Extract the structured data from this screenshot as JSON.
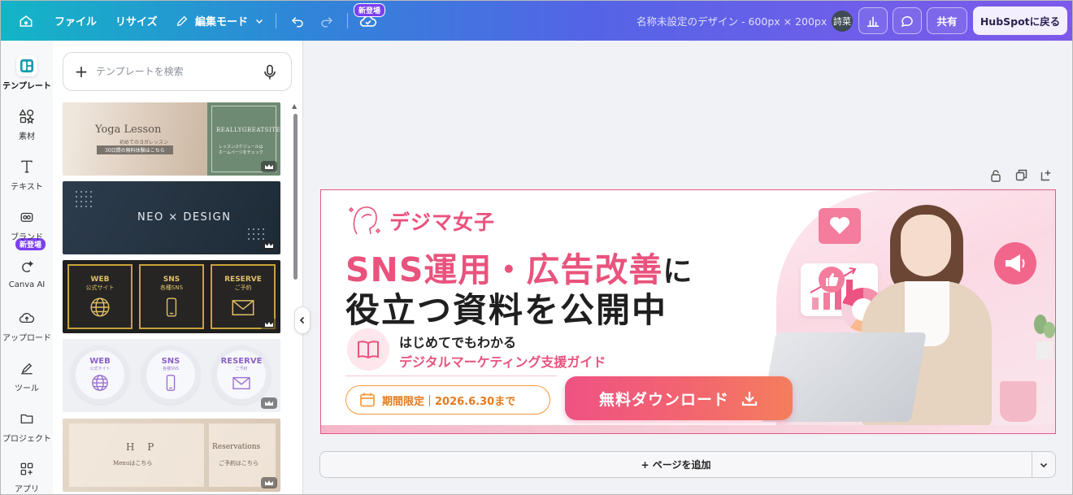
{
  "topbar": {
    "file": "ファイル",
    "resize": "リサイズ",
    "edit_mode": "編集モード",
    "new_badge": "新登場",
    "doc_title": "名称未設定のデザイン - 600px × 200px",
    "avatar": "詩菜",
    "share": "共有",
    "back": "HubSpotに戻る"
  },
  "rail": {
    "items": [
      {
        "label": "テンプレート",
        "icon": "templates-icon"
      },
      {
        "label": "素材",
        "icon": "elements-icon"
      },
      {
        "label": "テキスト",
        "icon": "text-icon"
      },
      {
        "label": "ブランド",
        "icon": "brand-icon"
      },
      {
        "label": "Canva AI",
        "icon": "canva-ai-icon"
      },
      {
        "label": "アップロード",
        "icon": "upload-icon"
      },
      {
        "label": "ツール",
        "icon": "tools-icon"
      },
      {
        "label": "プロジェクト",
        "icon": "folder-icon"
      },
      {
        "label": "アプリ",
        "icon": "apps-icon"
      }
    ],
    "brand_badge": "新登場"
  },
  "panel": {
    "search_placeholder": "テンプレートを検索",
    "templates": {
      "t1": {
        "title": "Yoga Lesson",
        "sub": "初めてのヨガレッスン",
        "bar": "30日間の無料体験はこちら",
        "right_title": "REALLYGREATSITE",
        "right_sub": "レッスンスケジュールは\nホームページをチェック"
      },
      "t2": {
        "title": "NEO × DESIGN"
      },
      "t3": {
        "cards": [
          {
            "t": "WEB",
            "s": "公式サイト"
          },
          {
            "t": "SNS",
            "s": "各種SNS"
          },
          {
            "t": "RESERVE",
            "s": "ご予約"
          }
        ]
      },
      "t4": {
        "cards": [
          {
            "t": "WEB",
            "s": "公式サイト"
          },
          {
            "t": "SNS",
            "s": "各種SNS"
          },
          {
            "t": "RESERVE",
            "s": "ご予約"
          }
        ]
      },
      "t5": {
        "left_title": "H P",
        "left_sub": "Menuはこちら",
        "right_title": "Reservations",
        "right_sub": "ご予約はこちら"
      }
    }
  },
  "banner": {
    "brand": "デジマ女子",
    "headline1": "SNS運用・広告改善",
    "headline1_suffix": "に",
    "headline2": "役立つ資料を公開中",
    "sub1": "はじめてでもわかる",
    "sub2": "デジタルマーケティング支援ガイド",
    "period": "期間限定｜2026.6.30まで",
    "cta": "無料ダウンロード"
  },
  "canvas": {
    "add_page": "+ ページを追加"
  },
  "colors": {
    "accent_pink": "#e9537d",
    "accent_orange": "#f39b3d",
    "badge_purple": "#7b3ff2"
  }
}
